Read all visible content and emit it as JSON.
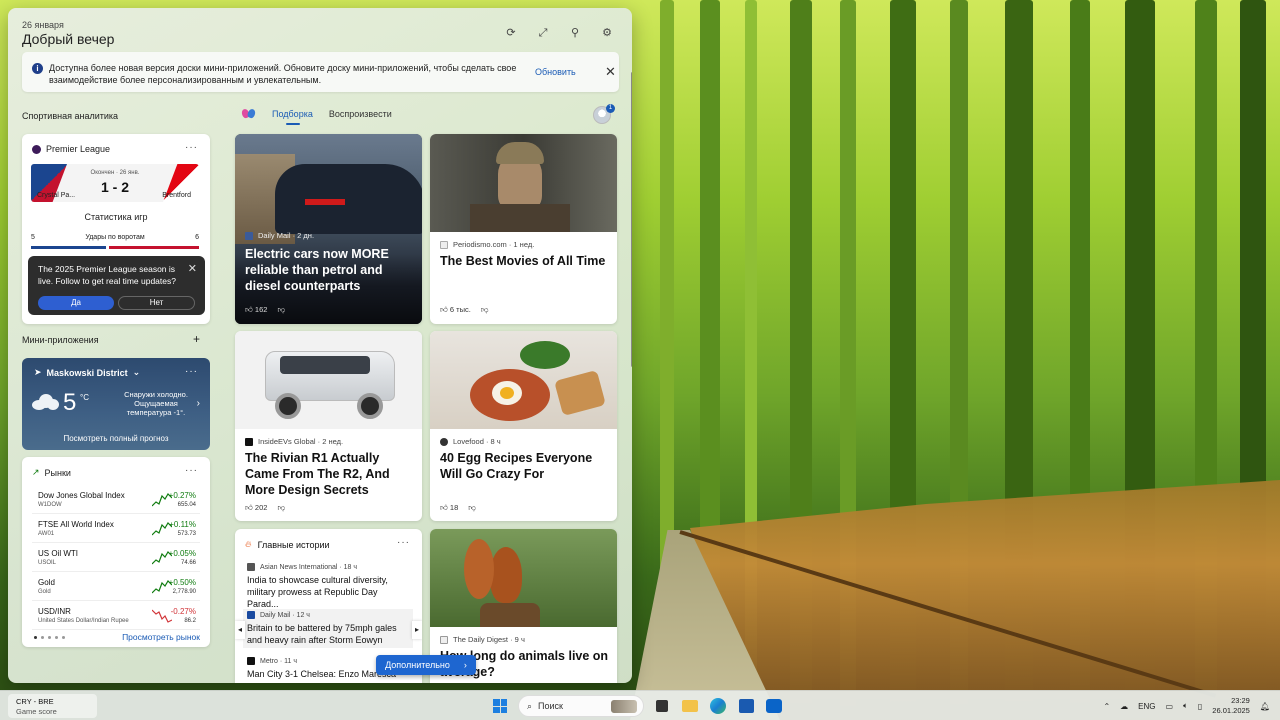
{
  "board": {
    "date": "26 января",
    "greeting": "Добрый вечер",
    "header_icons": [
      "refresh-icon",
      "expand-icon",
      "pin-icon",
      "settings-icon"
    ]
  },
  "banner": {
    "text": "Доступна более новая версия доски мини-приложений. Обновите доску мини-приложений, чтобы сделать свое взаимодействие более персонализированным и увлекательным.",
    "update_label": "Обновить"
  },
  "sports": {
    "section_title": "Спортивная аналитика",
    "league": "Premier League",
    "status": "Окончен · 26 янв.",
    "score": "1 - 2",
    "home": "Crystal Pa...",
    "away": "Brentford",
    "stats_title": "Статистика игр",
    "stat": {
      "label": "Удары по воротам",
      "home": "5",
      "away": "6"
    },
    "popup": {
      "text": "The 2025 Premier League season is live. Follow to get real time updates?",
      "yes": "Да",
      "no": "Нет"
    }
  },
  "miniapps_title": "Мини-приложения",
  "weather": {
    "location": "Maskowski District",
    "temp": "5",
    "unit": "°C",
    "desc": "Снаружи холодно. Ощущаемая температура -1°.",
    "link": "Посмотреть полный прогноз"
  },
  "markets": {
    "title": "Рынки",
    "rows": [
      {
        "name": "Dow Jones Global Index",
        "sym": "W1DOW",
        "chg": "+0.27%",
        "val": "655.04",
        "up": true
      },
      {
        "name": "FTSE All World Index",
        "sym": "AW01",
        "chg": "+0.11%",
        "val": "573.73",
        "up": true
      },
      {
        "name": "US Oil WTI",
        "sym": "USOIL",
        "chg": "+0.05%",
        "val": "74.66",
        "up": true
      },
      {
        "name": "Gold",
        "sym": "Gold",
        "chg": "+0.50%",
        "val": "2,778.90",
        "up": true
      },
      {
        "name": "USD/INR",
        "sym": "United States Dollar/Indian Rupee",
        "chg": "-0.27%",
        "val": "86.2",
        "up": false
      }
    ],
    "more": "Просмотреть рынок"
  },
  "feed": {
    "tabs": [
      "Подборка",
      "Воспроизвести"
    ],
    "avatar_badge": "1",
    "cards": [
      {
        "source": "Daily Mail · 2 дн.",
        "title": "Electric cars now MORE reliable than petrol and diesel counterparts",
        "likes": "162"
      },
      {
        "source": "Periodismo.com · 1 нед.",
        "title": "The Best Movies of All Time",
        "likes": "6 тыс."
      },
      {
        "source": "InsideEVs Global · 2 нед.",
        "title": "The Rivian R1 Actually Came From The R2, And More Design Secrets",
        "likes": "202"
      },
      {
        "source": "Lovefood · 8 ч",
        "title": "40 Egg Recipes Everyone Will Go Crazy For",
        "likes": "18"
      },
      {
        "source": "The Daily Digest · 9 ч",
        "title": "How long do animals live on average?"
      }
    ],
    "top_stories": {
      "title": "Главные истории",
      "items": [
        {
          "source": "Asian News International · 18 ч",
          "title": "India to showcase cultural diversity, military prowess at Republic Day Parad..."
        },
        {
          "source": "Daily Mail · 12 ч",
          "title": "Britain to be battered by 75mph gales and heavy rain after Storm Eowyn"
        },
        {
          "source": "Metro · 11 ч",
          "title": "Man City 3-1 Chelsea: Enzo Maresca"
        }
      ]
    },
    "more_label": "Дополнительно"
  },
  "taskbar": {
    "widget_l1": "CRY - BRE",
    "widget_l2": "Game score",
    "search": "Поиск",
    "lang": "ENG",
    "time": "23:29",
    "date": "26.01.2025"
  },
  "colors": {
    "accent": "#1e66d0",
    "up": "#107c10",
    "down": "#d13438"
  }
}
